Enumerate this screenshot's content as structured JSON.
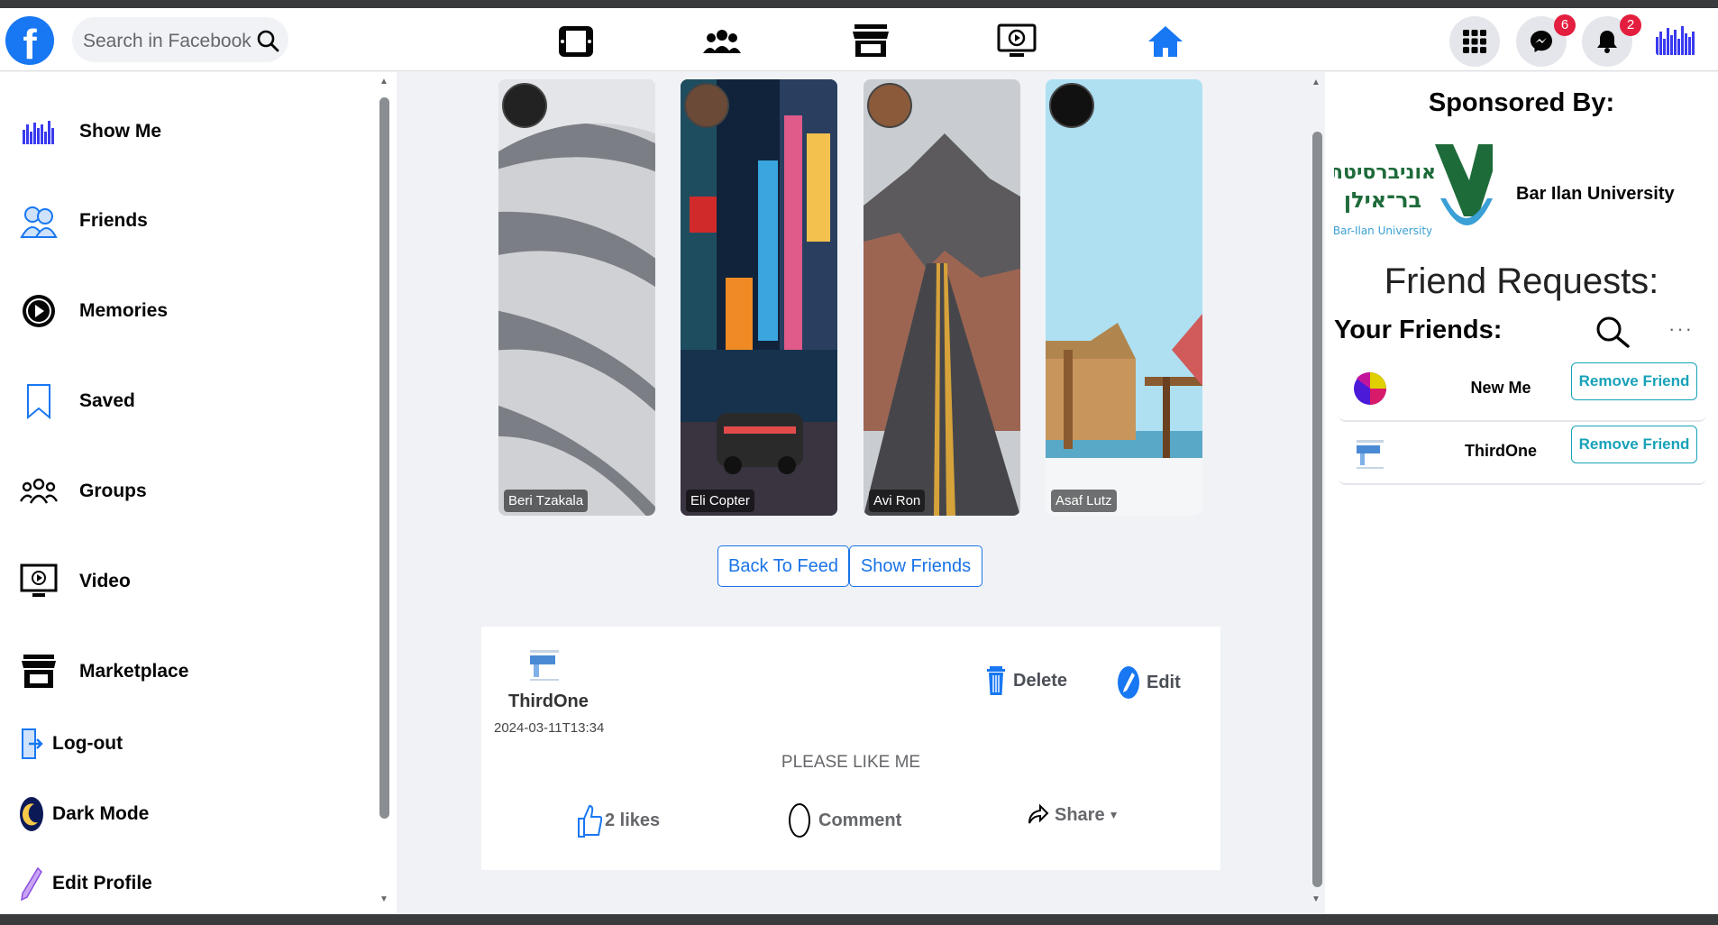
{
  "header": {
    "logo": "f",
    "search_placeholder": "Search in Facebook",
    "nav_icons": [
      "gaming-icon",
      "groups-icon",
      "marketplace-icon",
      "watch-icon",
      "home-icon"
    ],
    "messenger_badge": "6",
    "notifications_badge": "2",
    "accent": "#1877f2"
  },
  "sidebar": {
    "items": [
      {
        "label": "Show Me",
        "icon": "profile-avatar-icon"
      },
      {
        "label": "Friends",
        "icon": "friends-icon"
      },
      {
        "label": "Memories",
        "icon": "memories-icon"
      },
      {
        "label": "Saved",
        "icon": "bookmark-icon"
      },
      {
        "label": "Groups",
        "icon": "groups-icon"
      },
      {
        "label": "Video",
        "icon": "video-icon"
      },
      {
        "label": "Marketplace",
        "icon": "marketplace-icon"
      },
      {
        "label": "Log-out",
        "icon": "logout-icon"
      },
      {
        "label": "Dark Mode",
        "icon": "moon-icon"
      },
      {
        "label": "Edit Profile",
        "icon": "pencil-icon"
      }
    ]
  },
  "stories": [
    {
      "name": "Beri Tzakala"
    },
    {
      "name": "Eli Copter"
    },
    {
      "name": "Avi Ron"
    },
    {
      "name": "Asaf Lutz"
    }
  ],
  "feed_buttons": {
    "back": "Back To Feed",
    "show_friends": "Show Friends"
  },
  "post": {
    "author": "ThirdOne",
    "date": "2024-03-11T13:34",
    "delete_label": "Delete",
    "edit_label": "Edit",
    "text": "PLEASE LIKE ME",
    "likes_label": "2 likes",
    "comment_label": "Comment",
    "share_label": "Share"
  },
  "right": {
    "sponsored_title": "Sponsored By:",
    "sponsor_name": "Bar Ilan University",
    "sponsor_logo_hebrew_1": "אוניברסיטת",
    "sponsor_logo_hebrew_2": "בר־אילן",
    "sponsor_logo_english": "Bar-Ilan University",
    "friend_requests_title": "Friend Requests:",
    "your_friends_title": "Your Friends:",
    "friends": [
      {
        "name": "New Me",
        "button": "Remove Friend"
      },
      {
        "name": "ThirdOne",
        "button": "Remove Friend"
      }
    ],
    "more_label": "···"
  }
}
